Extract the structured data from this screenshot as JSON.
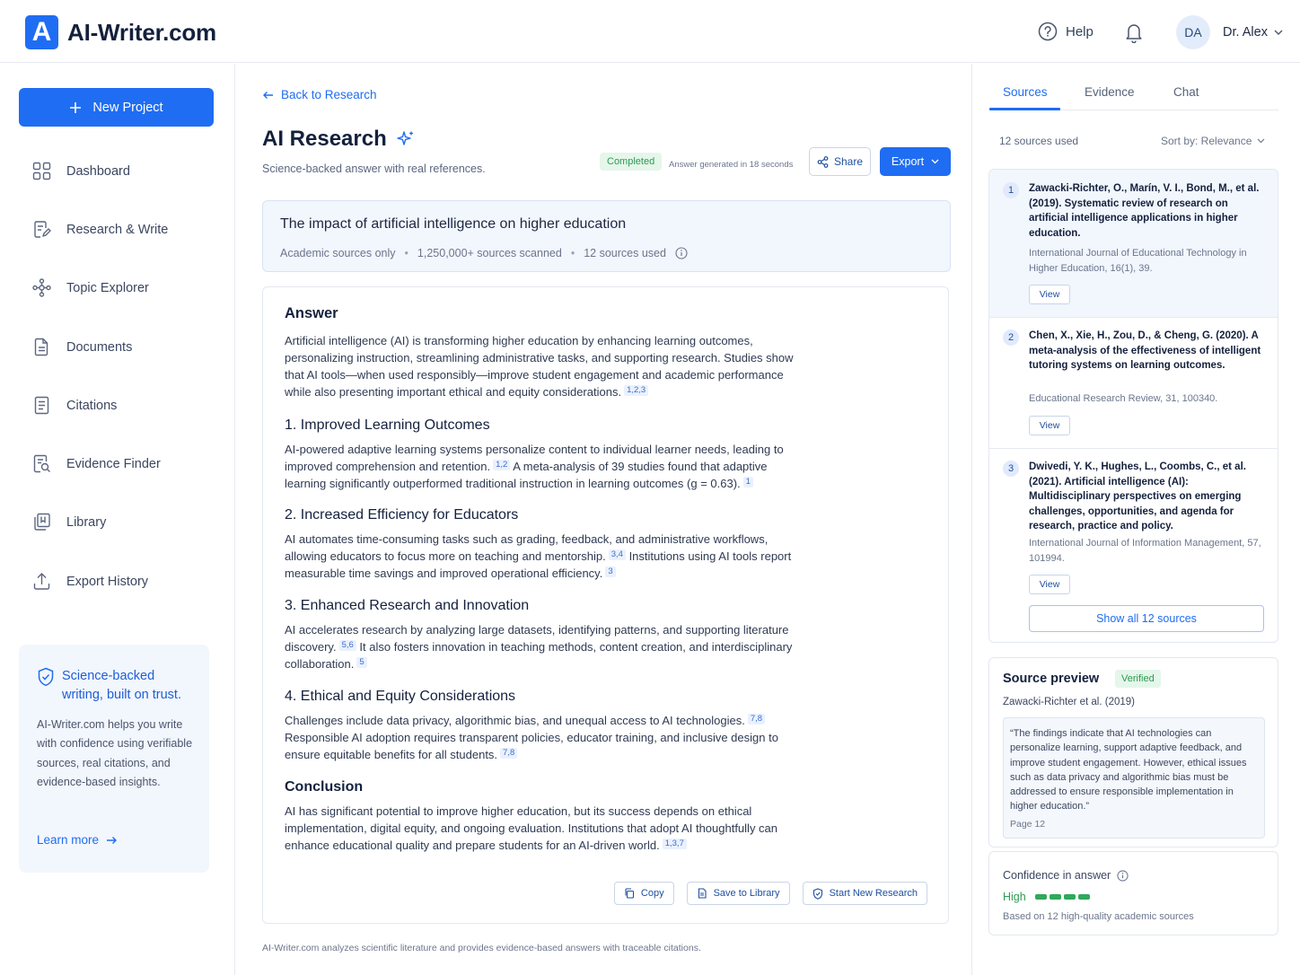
{
  "header": {
    "logo_letter": "A",
    "app_name": "AI-Writer.com",
    "help_label": "Help",
    "avatar_initials": "DA",
    "user_name": "Dr. Alex"
  },
  "sidebar": {
    "new_project_label": "New Project",
    "items": [
      {
        "label": "Dashboard",
        "icon": "grid-icon"
      },
      {
        "label": "Research & Write",
        "icon": "edit-document-icon"
      },
      {
        "label": "Topic Explorer",
        "icon": "topic-network-icon"
      },
      {
        "label": "Documents",
        "icon": "document-icon"
      },
      {
        "label": "Citations",
        "icon": "citation-list-icon"
      },
      {
        "label": "Evidence Finder",
        "icon": "search-document-icon"
      },
      {
        "label": "Library",
        "icon": "library-icon"
      },
      {
        "label": "Export History",
        "icon": "upload-icon"
      }
    ],
    "promo": {
      "title": "Science-backed writing, built on trust.",
      "body": "AI-Writer.com helps you write with confidence using verifiable sources, real citations, and evidence-based insights.",
      "link": "Learn more"
    }
  },
  "main": {
    "back_label": "Back to Research",
    "title": "AI Research",
    "subtitle": "Science-backed answer with real references.",
    "status_badge": "Completed",
    "generated_note": "Answer generated in 18 seconds",
    "share_label": "Share",
    "export_label": "Export",
    "query": {
      "text": "The impact of artificial intelligence on higher education",
      "meta": [
        "Academic sources only",
        "1,250,000+ sources scanned",
        "12 sources used"
      ]
    },
    "answer": {
      "heading": "Answer",
      "intro": {
        "text": "Artificial intelligence (AI) is transforming higher education by enhancing learning outcomes, personalizing instruction, streamlining administrative tasks, and supporting research. Studies show that AI tools—when used responsibly—improve student engagement and academic performance while also presenting important ethical and equity considerations.",
        "cite": "1,2,3"
      },
      "sections": [
        {
          "title": "1. Improved Learning Outcomes",
          "parts": [
            {
              "text": "AI-powered adaptive learning systems personalize content to individual learner needs, leading to improved comprehension and retention.",
              "cite": "1,2"
            },
            {
              "text": "A meta-analysis of 39 studies found that adaptive learning significantly outperformed traditional instruction in learning outcomes (g = 0.63).",
              "cite": "1"
            }
          ]
        },
        {
          "title": "2. Increased Efficiency for Educators",
          "parts": [
            {
              "text": "AI automates time-consuming tasks such as grading, feedback, and administrative workflows, allowing educators to focus more on teaching and mentorship.",
              "cite": "3,4"
            },
            {
              "text": "Institutions using AI tools report measurable time savings and improved operational efficiency.",
              "cite": "3"
            }
          ]
        },
        {
          "title": "3. Enhanced Research and Innovation",
          "parts": [
            {
              "text": "AI accelerates research by analyzing large datasets, identifying patterns, and supporting literature discovery.",
              "cite": "5,6"
            },
            {
              "text": "It also fosters innovation in teaching methods, content creation, and interdisciplinary collaboration.",
              "cite": "5"
            }
          ]
        },
        {
          "title": "4. Ethical and Equity Considerations",
          "parts": [
            {
              "text": "Challenges include data privacy, algorithmic bias, and unequal access to AI technologies.",
              "cite": "7,8"
            },
            {
              "text": "Responsible AI adoption requires transparent policies, educator training, and inclusive design to ensure equitable benefits for all students.",
              "cite": "7,8"
            }
          ]
        },
        {
          "title": "Conclusion",
          "parts": [
            {
              "text": "AI has significant potential to improve higher education, but its success depends on ethical implementation, digital equity, and ongoing evaluation. Institutions that adopt AI thoughtfully can enhance educational quality and prepare students for an AI-driven world.",
              "cite": "1,3,7"
            }
          ]
        }
      ],
      "actions": {
        "copy": "Copy",
        "save": "Save to Library",
        "start_new": "Start New Research"
      }
    },
    "footer_note": "AI-Writer.com analyzes scientific literature and provides evidence-based answers with traceable citations."
  },
  "right_panel": {
    "tabs": [
      "Sources",
      "Evidence",
      "Chat"
    ],
    "sources_used": "12 sources used",
    "sort_label": "Sort by: Relevance",
    "sources": [
      {
        "num": "1",
        "citation": "Zawacki-Richter, O., Marín, V. I., Bond, M., et al. (2019). Systematic review of research on artificial intelligence applications in higher education.",
        "journal": "International Journal of Educational Technology in Higher Education, 16(1), 39.",
        "view": "View"
      },
      {
        "num": "2",
        "citation": "Chen, X., Xie, H., Zou, D., & Cheng, G. (2020). A meta-analysis of the effectiveness of intelligent tutoring systems on learning outcomes.",
        "journal": "Educational Research Review, 31, 100340.",
        "view": "View"
      },
      {
        "num": "3",
        "citation": "Dwivedi, Y. K., Hughes, L., Coombs, C., et al. (2021). Artificial intelligence (AI): Multidisciplinary perspectives on emerging challenges, opportunities, and agenda for research, practice and policy.",
        "journal": "International Journal of Information Management, 57, 101994.",
        "view": "View"
      }
    ],
    "show_all": "Show all 12 sources",
    "preview": {
      "title": "Source preview",
      "badge": "Verified",
      "author": "Zawacki-Richter et al. (2019)",
      "quote": "“The findings indicate that AI technologies can personalize learning, support adaptive feedback, and improve student engagement. However, ethical issues such as data privacy and algorithmic bias must be addressed to ensure responsible implementation in higher education.”",
      "page": "Page 12"
    },
    "confidence": {
      "title": "Confidence in answer",
      "level": "High",
      "filled_segments": 4,
      "total_segments": 4,
      "note": "Based on 12 high-quality academic sources"
    }
  },
  "colors": {
    "accent": "#1f6df2",
    "success": "#2e9a52"
  }
}
